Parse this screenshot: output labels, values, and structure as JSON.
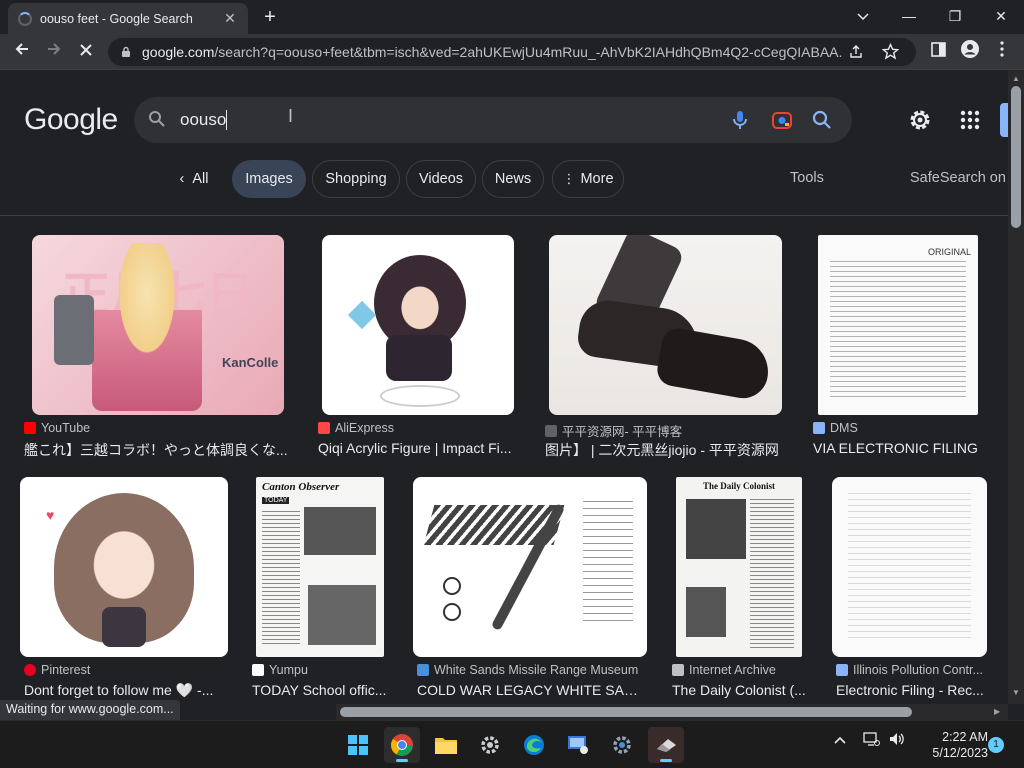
{
  "tab": {
    "title": "oouso feet - Google Search",
    "close": "✕"
  },
  "window": {
    "minimize": "—",
    "restore": "❐",
    "close": "✕",
    "dropdown": "⌄",
    "newtab": "+"
  },
  "omnibox": {
    "domain": "google.com",
    "path": "/search?q=oouso+feet&tbm=isch&ved=2ahUKEwjUu4mRuu_-AhVbK2IAHdhQBm4Q2-cCegQIABAA..."
  },
  "google": {
    "logo": "Google",
    "query": "oouso",
    "chips": [
      {
        "label": "All",
        "selected": false,
        "plain": true
      },
      {
        "label": "Images",
        "selected": true
      },
      {
        "label": "Shopping",
        "selected": false
      },
      {
        "label": "Videos",
        "selected": false
      },
      {
        "label": "News",
        "selected": false
      },
      {
        "label": "More",
        "selected": false
      }
    ],
    "tools": "Tools",
    "safesearch": "SafeSearch on"
  },
  "results": [
    {
      "source": "YouTube",
      "caption": "艦これ】三越コラボ！やっと体調良くな...",
      "fav": "#ff0000"
    },
    {
      "source": "AliExpress",
      "caption": "Qiqi Acrylic Figure | Impact Fi...",
      "fav": "#ff4747"
    },
    {
      "source": "平平资源网- 平平博客",
      "caption": "图片】 | 二次元黑丝jiojio - 平平资源网",
      "fav": "#5f6368"
    },
    {
      "source": "DMS",
      "caption": "VIA ELECTRONIC FILING",
      "fav": "#8ab4f8"
    },
    {
      "source": "Pinterest",
      "caption": "Dont forget to follow me 🤍 -...",
      "fav": "#e60023"
    },
    {
      "source": "Yumpu",
      "caption": "TODAY School offic...",
      "fav": "#ffffff"
    },
    {
      "source": "White Sands Missile Range Museum",
      "caption": "COLD WAR LEGACY WHITE SAND...",
      "fav": "#4a90d9"
    },
    {
      "source": "Internet Archive",
      "caption": "The Daily Colonist (...",
      "fav": "#bdc1c6"
    },
    {
      "source": "Illinois Pollution Contr...",
      "caption": "Electronic Filing - Rec...",
      "fav": "#8ab4f8"
    }
  ],
  "thumbs": {
    "kancolle_text": "KanColle",
    "canton_masthead": "Canton Observer",
    "canton_today": "TODAY",
    "colonist_masthead": "The Daily Colonist",
    "original": "ORIGINAL"
  },
  "status": "Waiting for www.google.com...",
  "clock": {
    "time": "2:22 AM",
    "date": "5/12/2023"
  },
  "notifications": "1"
}
